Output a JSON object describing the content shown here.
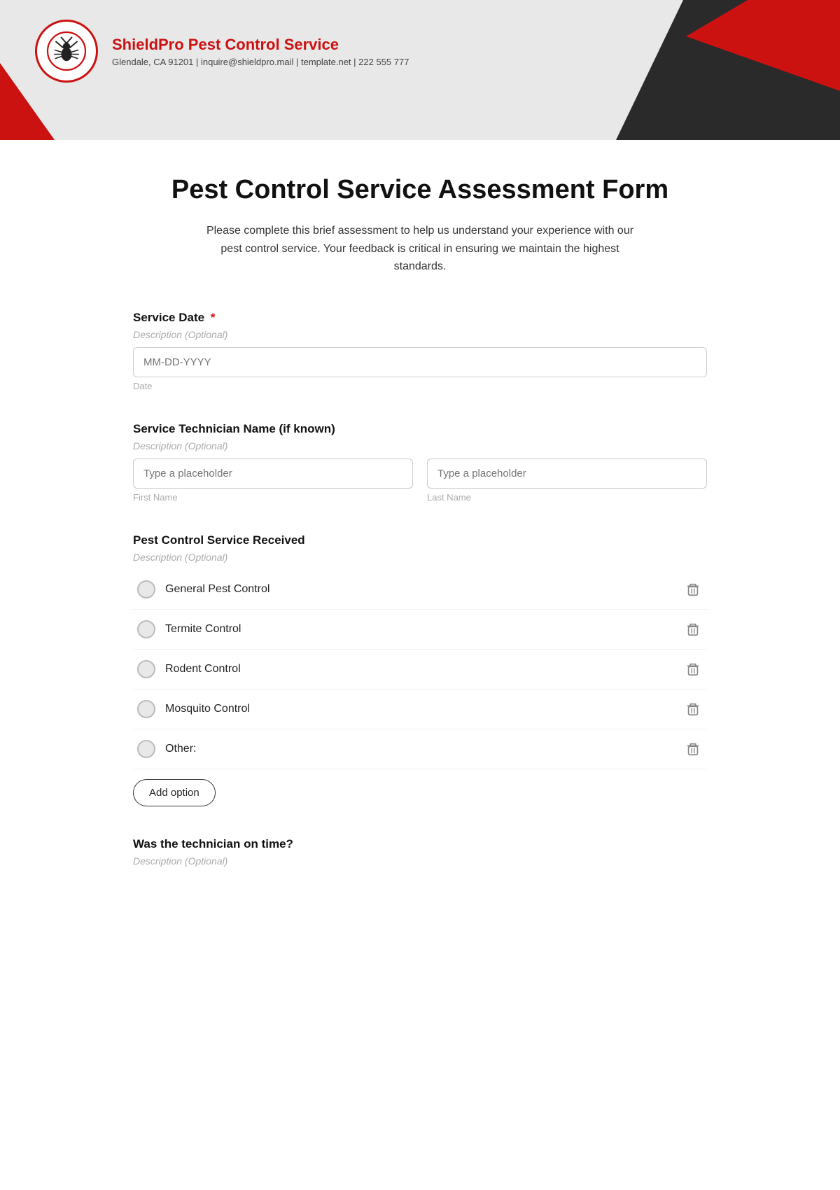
{
  "header": {
    "company_name": "ShieldPro Pest Control Service",
    "company_details": "Glendale, CA 91201 | inquire@shieldpro.mail | template.net | 222 555 777"
  },
  "form": {
    "title": "Pest Control Service Assessment Form",
    "description": "Please complete this brief assessment to help us understand your experience with our pest control service. Your feedback is critical in ensuring we maintain the highest standards.",
    "fields": [
      {
        "id": "service_date",
        "label": "Service Date",
        "required": true,
        "description": "Description (Optional)",
        "placeholder": "MM-DD-YYYY",
        "sub_label": "Date",
        "type": "date_input"
      },
      {
        "id": "technician_name",
        "label": "Service Technician Name (if known)",
        "required": false,
        "description": "Description (Optional)",
        "type": "name_fields",
        "first": {
          "placeholder": "Type a placeholder",
          "sub_label": "First Name"
        },
        "last": {
          "placeholder": "Type a placeholder",
          "sub_label": "Last Name"
        }
      },
      {
        "id": "service_received",
        "label": "Pest Control Service Received",
        "required": false,
        "description": "Description (Optional)",
        "type": "radio",
        "options": [
          {
            "id": "opt1",
            "text": "General Pest Control"
          },
          {
            "id": "opt2",
            "text": "Termite Control"
          },
          {
            "id": "opt3",
            "text": "Rodent Control"
          },
          {
            "id": "opt4",
            "text": "Mosquito Control"
          },
          {
            "id": "opt5",
            "text": "Other:"
          }
        ],
        "add_option_label": "Add option"
      },
      {
        "id": "on_time",
        "label": "Was the technician on time?",
        "required": false,
        "description": "Description (Optional)",
        "type": "radio",
        "options": []
      }
    ]
  },
  "icons": {
    "delete": "🗑",
    "logo_bug": "🛡"
  },
  "colors": {
    "red": "#cc1111",
    "dark": "#2a2a2a",
    "light_gray": "#e8e8e8"
  }
}
